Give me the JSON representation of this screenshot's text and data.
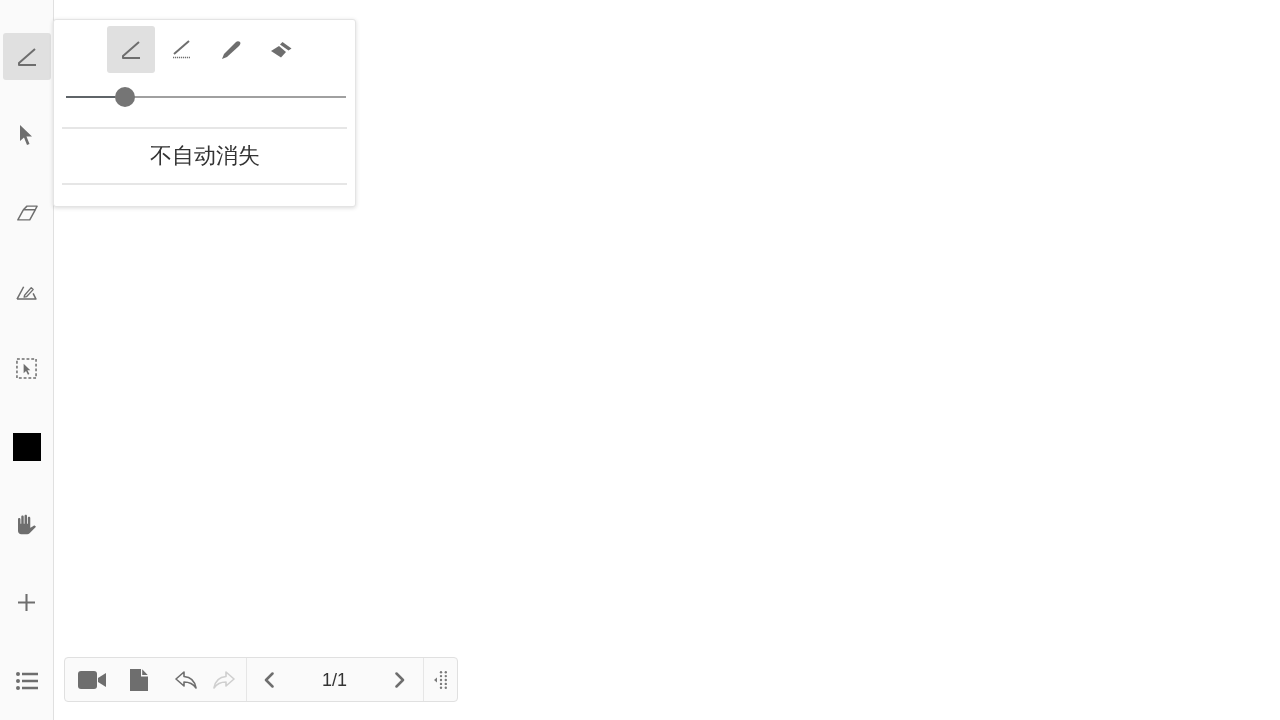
{
  "sidebar": {
    "tools": [
      {
        "kind": "pen",
        "selected": true
      },
      {
        "kind": "pointer",
        "selected": false
      },
      {
        "kind": "eraser",
        "selected": false
      },
      {
        "kind": "shape",
        "selected": false
      },
      {
        "kind": "select",
        "selected": false
      },
      {
        "kind": "color",
        "selected": false,
        "color": "#000000"
      },
      {
        "kind": "hand",
        "selected": false
      },
      {
        "kind": "add",
        "selected": false
      },
      {
        "kind": "list",
        "selected": false
      }
    ]
  },
  "pen_popup": {
    "pen_types": [
      {
        "kind": "pen",
        "selected": true
      },
      {
        "kind": "dotted_pen",
        "selected": false
      },
      {
        "kind": "brush",
        "selected": false
      },
      {
        "kind": "highlighter",
        "selected": false
      }
    ],
    "width_slider": {
      "level": 0.21
    },
    "option": "不自动消失"
  },
  "bottom_toolbar": {
    "actions": [
      {
        "kind": "video",
        "disabled": false
      },
      {
        "kind": "document",
        "disabled": false
      },
      {
        "kind": "undo",
        "disabled": false
      },
      {
        "kind": "redo",
        "disabled": true
      }
    ],
    "page_indicator": "1/1"
  }
}
